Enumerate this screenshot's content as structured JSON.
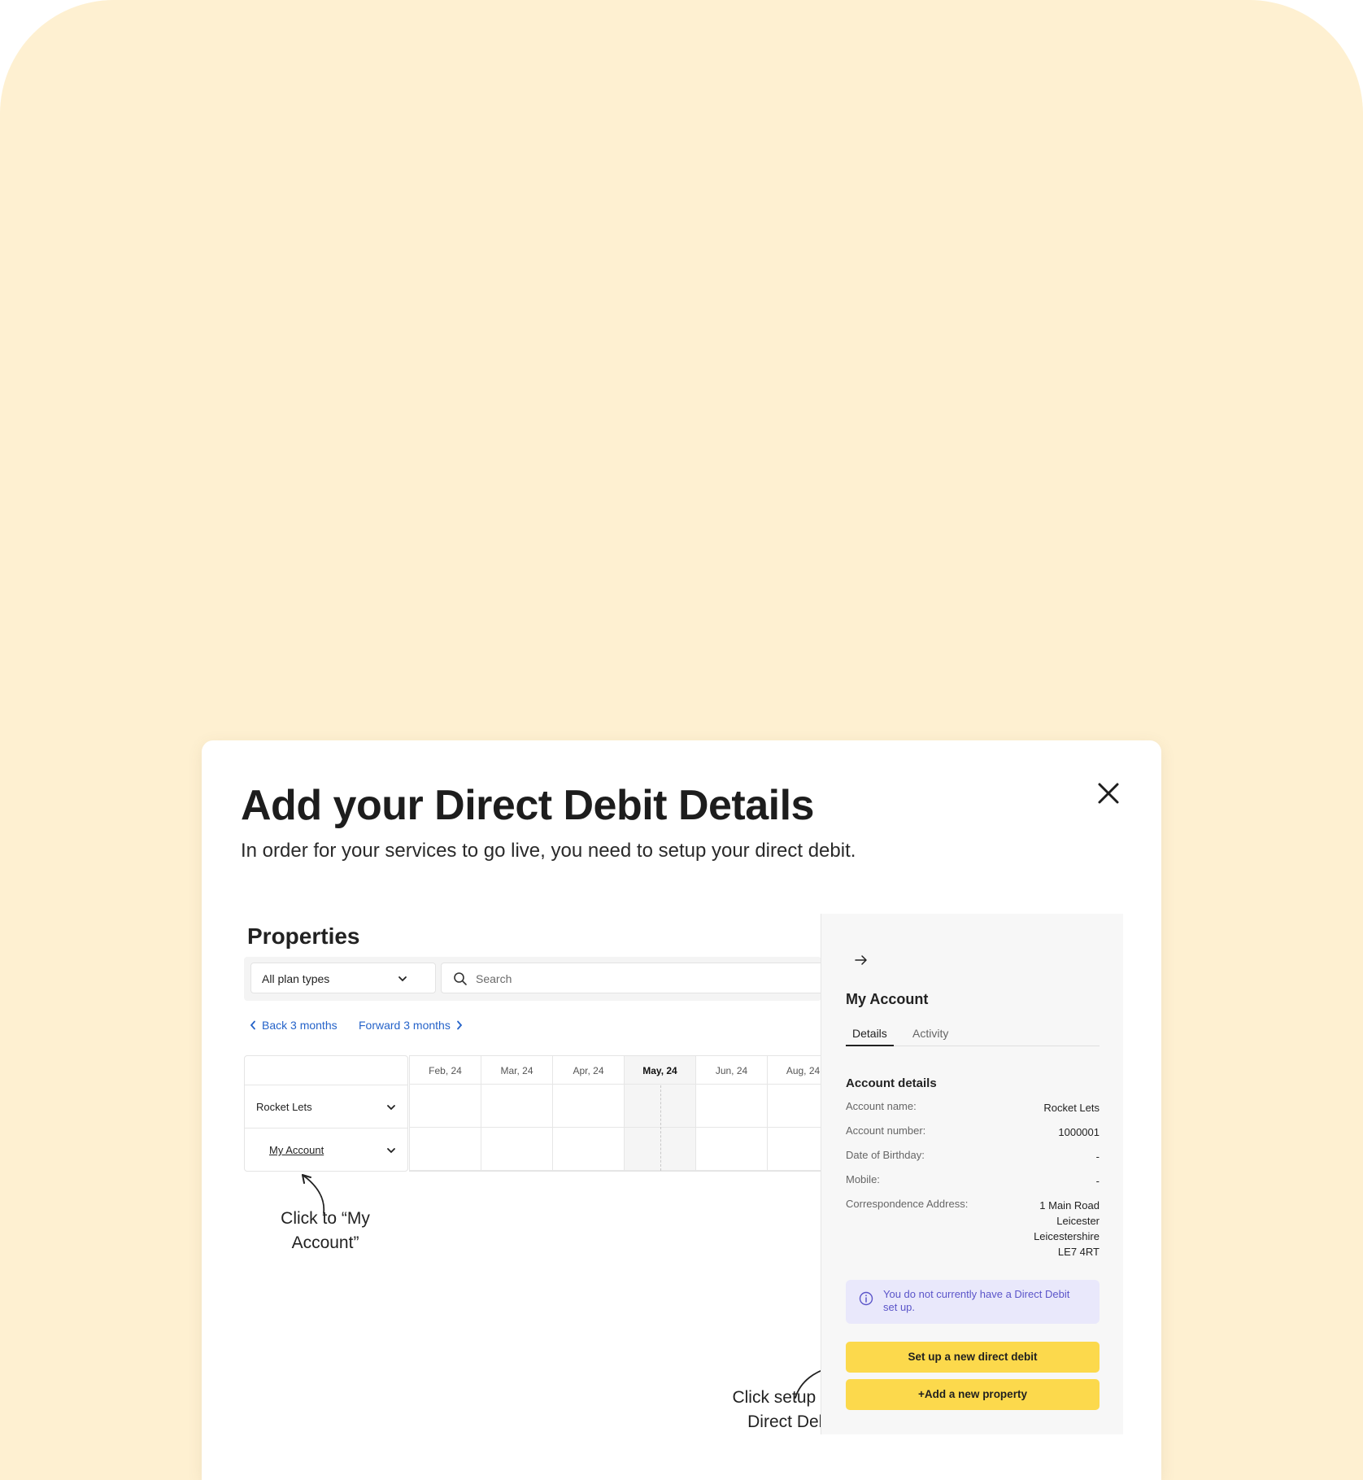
{
  "modal": {
    "title": "Add your Direct Debit Details",
    "subtitle": "In order for your services to go live, you need to setup your direct debit."
  },
  "properties": {
    "heading": "Properties",
    "plan_select": "All plan types",
    "search_placeholder": "Search",
    "back_link": "Back 3 months",
    "forward_link": "Forward 3 months",
    "months": [
      "Feb, 24",
      "Mar, 24",
      "Apr, 24",
      "May, 24",
      "Jun, 24",
      "Aug, 24"
    ],
    "current_month": "May, 24",
    "rows": [
      {
        "label": "Rocket Lets"
      },
      {
        "label": "My Account"
      }
    ]
  },
  "annotations": {
    "click_account_line1": "Click to “My",
    "click_account_line2": "Account”",
    "click_dd_line1": "Click setup new",
    "click_dd_line2": "Direct Debit"
  },
  "panel": {
    "title": "My Account",
    "tabs": [
      "Details",
      "Activity"
    ],
    "active_tab": "Details",
    "section_title": "Account details",
    "fields": [
      {
        "label": "Account name:",
        "value": "Rocket Lets"
      },
      {
        "label": "Account number:",
        "value": "1000001"
      },
      {
        "label": "Date of Birthday:",
        "value": "-"
      },
      {
        "label": "Mobile:",
        "value": "-"
      },
      {
        "label": "Correspondence Address:",
        "value_lines": [
          "1 Main Road",
          "Leicester",
          "Leicestershire",
          "LE7 4RT"
        ]
      }
    ],
    "info_line1": "You do not currently have a Direct Debit",
    "info_line2": "set up.",
    "primary_button": "Set up a new direct debit",
    "secondary_button": "+Add a new property"
  },
  "colors": {
    "backdrop": "#fef0d1",
    "accent_yellow": "#fcd94c",
    "link_blue": "#2563c9",
    "info_bg": "#e9e8fb",
    "info_text": "#5b55c9"
  }
}
